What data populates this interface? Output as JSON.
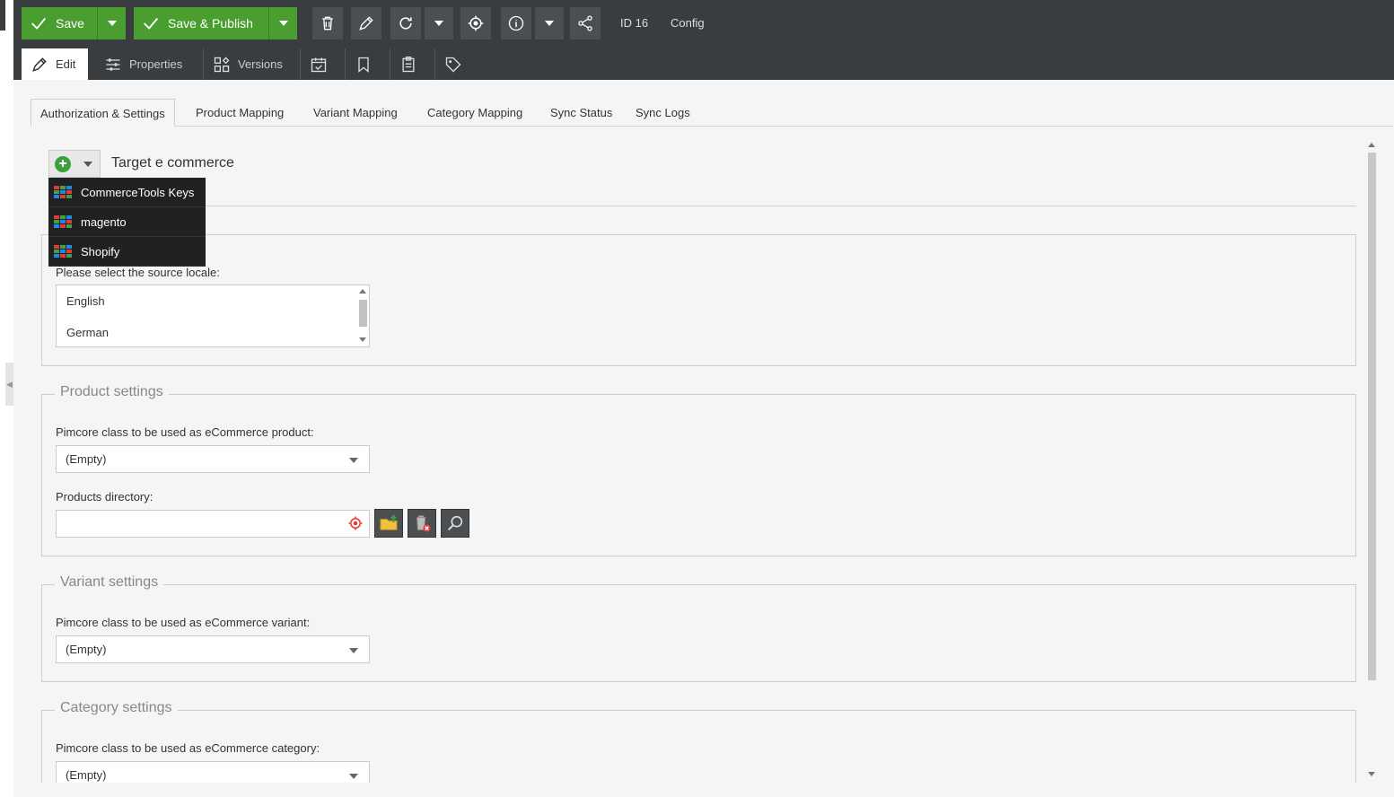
{
  "toolbar": {
    "save_label": "Save",
    "save_publish_label": "Save & Publish",
    "id_label": "ID 16",
    "config_label": "Config"
  },
  "tabs": {
    "edit": "Edit",
    "properties": "Properties",
    "versions": "Versions"
  },
  "subtabs": [
    "Authorization & Settings",
    "Product Mapping",
    "Variant Mapping",
    "Category Mapping",
    "Sync Status",
    "Sync Logs"
  ],
  "target": {
    "title": "Target e commerce",
    "menu": [
      "CommerceTools Keys",
      "magento",
      "Shopify"
    ]
  },
  "locale": {
    "label": "Please select the source locale:",
    "options": [
      "English",
      "German"
    ]
  },
  "product_settings": {
    "legend": "Product settings",
    "class_label": "Pimcore class to be used as eCommerce product:",
    "class_value": "(Empty)",
    "dir_label": "Products directory:",
    "dir_value": ""
  },
  "variant_settings": {
    "legend": "Variant settings",
    "class_label": "Pimcore class to be used as eCommerce variant:",
    "class_value": "(Empty)"
  },
  "category_settings": {
    "legend": "Category settings",
    "class_label": "Pimcore class to be used as eCommerce category:",
    "class_value": "(Empty)"
  },
  "colors": {
    "accent_green": "#4a9d2f",
    "toolbar_bg": "#3a3d3f"
  }
}
